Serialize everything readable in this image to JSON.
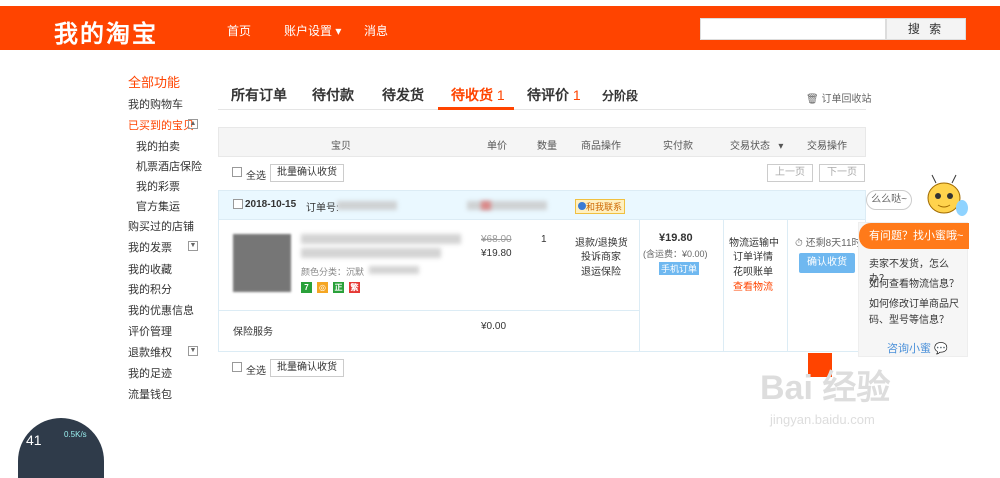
{
  "header": {
    "brand": "我的淘宝",
    "nav": [
      "首页",
      "账户设置",
      "消息"
    ],
    "nav_dropdown": "▾",
    "search_placeholder": "",
    "search_button": "搜 索"
  },
  "sidebar": {
    "items": [
      {
        "label": "全部功能",
        "style": "red big"
      },
      {
        "label": "我的购物车",
        "style": ""
      },
      {
        "label": "已买到的宝贝",
        "style": "red",
        "toggle": "▲"
      },
      {
        "label": "我的拍卖",
        "style": "sub"
      },
      {
        "label": "机票酒店保险",
        "style": "sub"
      },
      {
        "label": "我的彩票",
        "style": "sub"
      },
      {
        "label": "官方集运",
        "style": "sub"
      },
      {
        "label": "购买过的店铺",
        "style": ""
      },
      {
        "label": "我的发票",
        "style": "",
        "toggle": "▼"
      },
      {
        "label": "我的收藏",
        "style": ""
      },
      {
        "label": "我的积分",
        "style": ""
      },
      {
        "label": "我的优惠信息",
        "style": ""
      },
      {
        "label": "评价管理",
        "style": ""
      },
      {
        "label": "退款维权",
        "style": "",
        "toggle": "▼"
      },
      {
        "label": "我的足迹",
        "style": ""
      },
      {
        "label": "流量钱包",
        "style": ""
      }
    ]
  },
  "tabs": {
    "all": "所有订单",
    "pending_pay": "待付款",
    "pending_ship": "待发货",
    "pending_receive": "待收货",
    "pending_receive_count": "1",
    "pending_review": "待评价",
    "pending_review_count": "1",
    "staged": "分阶段",
    "recycle_bin": "订单回收站"
  },
  "table_headers": {
    "item": "宝贝",
    "price": "单价",
    "qty": "数量",
    "item_ops": "商品操作",
    "paid": "实付款",
    "status": "交易状态",
    "status_arrow": "▾",
    "ops": "交易操作"
  },
  "toolbar": {
    "select_all": "全选",
    "batch_confirm": "批量确认收货",
    "prev_page": "上一页",
    "next_page": "下一页"
  },
  "order": {
    "date": "2018-10-15",
    "order_no_label": "订单号:",
    "contact_seller": "和我联系",
    "variant_label": "颜色分类：沉默",
    "original_price": "¥68.00",
    "price": "¥19.80",
    "quantity": "1",
    "refund": "退款/退换货",
    "complaint": "投诉商家",
    "return_insurance": "退运保险",
    "total": "¥19.80",
    "shipping": "(含运费：¥0.00)",
    "mobile_order": "手机订单",
    "logistics_status": "物流运输中",
    "order_detail": "订单详情",
    "huabei_bill": "花呗账单",
    "view_logistics": "查看物流",
    "remaining": "还剩8天11时",
    "confirm_receipt": "确认收货",
    "insurance_label": "保险服务",
    "insurance_price": "¥0.00",
    "badges": [
      {
        "text": "7",
        "color": "#2aa13a"
      },
      {
        "text": "◎",
        "color": "#f5a623"
      },
      {
        "text": "正",
        "color": "#2aa13a"
      },
      {
        "text": "繁",
        "color": "#e53935"
      }
    ]
  },
  "help": {
    "bubble": "么么哒~",
    "title": "有问题？找小蜜哦~",
    "questions": [
      "卖家不发货，怎么办？",
      "如何查看物流信息？",
      "如何修改订单商品尺",
      "码、型号等信息？"
    ],
    "ask": "咨询小蜜"
  },
  "watermark": {
    "text": "Bai 经验",
    "url": "jingyan.baidu.com"
  },
  "widget": {
    "percent": "41",
    "speed": "0.5K/s"
  },
  "colors": {
    "brand": "#ff4400",
    "link_blue": "#4a90d9",
    "order_header_bg": "#eaf8ff"
  }
}
